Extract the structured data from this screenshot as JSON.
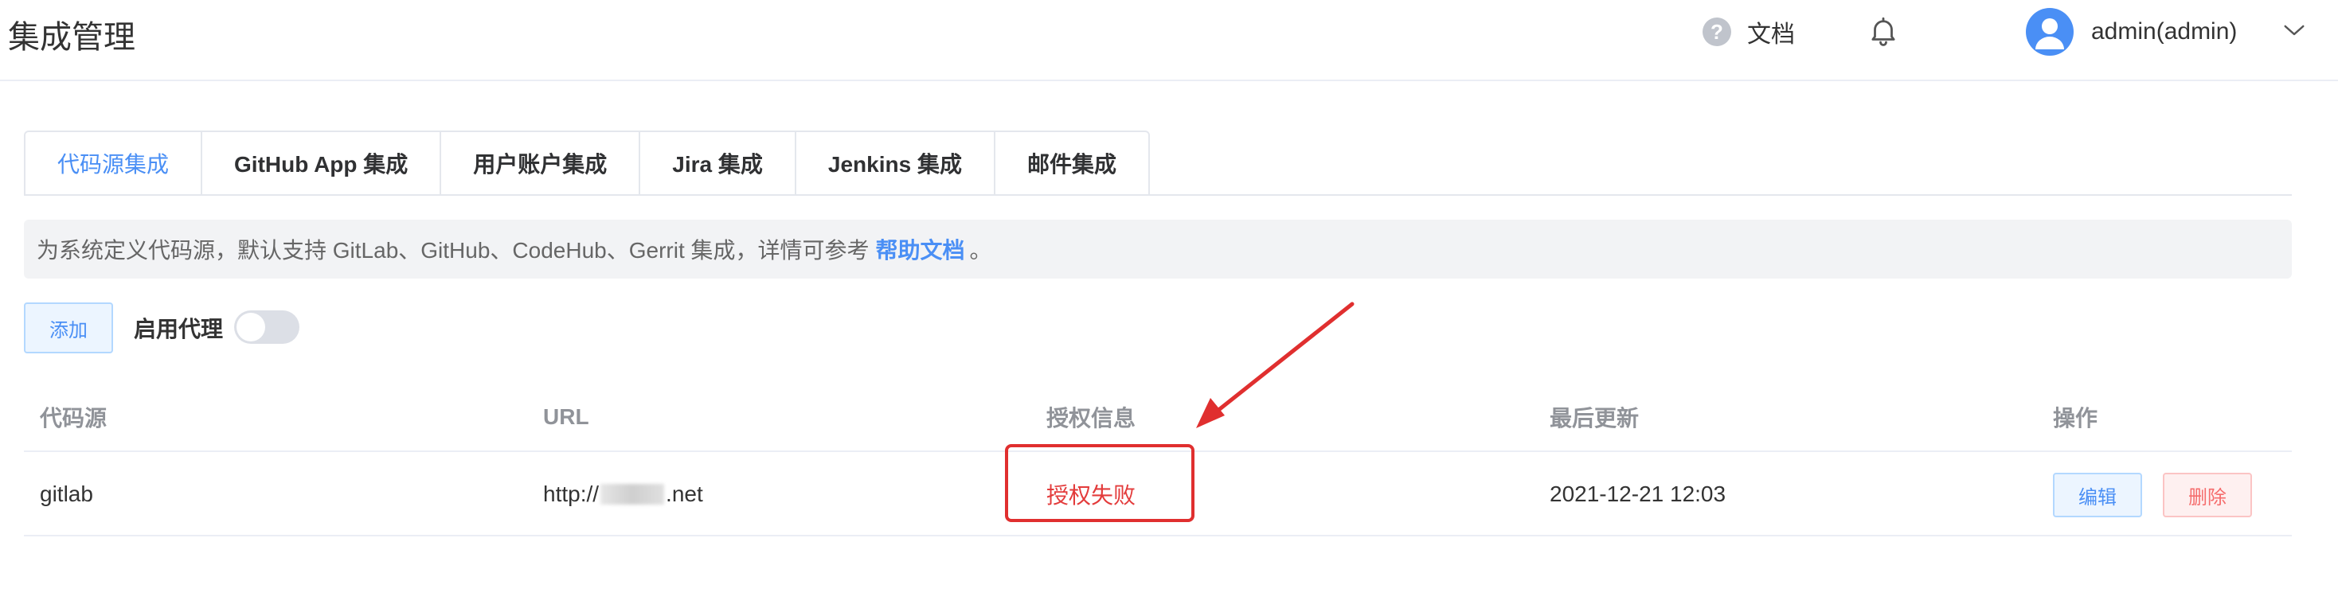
{
  "header": {
    "title": "集成管理",
    "docs_label": "文档",
    "user_name": "admin(admin)"
  },
  "tabs": [
    {
      "label": "代码源集成",
      "active": true
    },
    {
      "label": "GitHub App 集成",
      "active": false
    },
    {
      "label": "用户账户集成",
      "active": false
    },
    {
      "label": "Jira 集成",
      "active": false
    },
    {
      "label": "Jenkins 集成",
      "active": false
    },
    {
      "label": "邮件集成",
      "active": false
    }
  ],
  "info": {
    "text": "为系统定义代码源，默认支持 GitLab、GitHub、CodeHub、Gerrit 集成，详情可参考",
    "link_label": "帮助文档",
    "suffix": "。"
  },
  "actions": {
    "add_label": "添加",
    "proxy_label": "启用代理",
    "proxy_enabled": false
  },
  "table": {
    "columns": [
      "代码源",
      "URL",
      "授权信息",
      "最后更新",
      "操作"
    ],
    "rows": [
      {
        "source": "gitlab",
        "url_prefix": "http://",
        "url_suffix": ".net",
        "auth": "授权失败",
        "updated": "2021-12-21 12:03",
        "edit_label": "编辑",
        "delete_label": "删除"
      }
    ]
  },
  "colors": {
    "accent": "#4a8ff5",
    "danger": "#e33b3b",
    "annotation": "#e02f2f"
  },
  "icons": {
    "help": "help-icon",
    "bell": "bell-icon",
    "avatar": "avatar-icon",
    "chevron": "chevron-down-icon",
    "arrow": "annotation-arrow"
  }
}
